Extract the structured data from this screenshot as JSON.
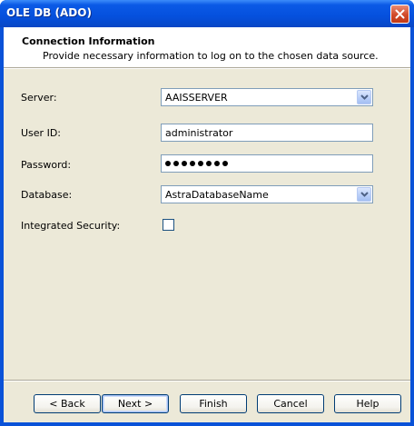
{
  "window": {
    "title": "OLE DB (ADO)"
  },
  "header": {
    "title": "Connection Information",
    "subtitle": "Provide necessary information to log on to the chosen data source."
  },
  "form": {
    "server": {
      "label": "Server:",
      "value": "AAISSERVER"
    },
    "user_id": {
      "label": "User ID:",
      "value": "administrator"
    },
    "password": {
      "label": "Password:",
      "value": "••••••••"
    },
    "database": {
      "label": "Database:",
      "value": "AstraDatabaseName"
    },
    "integrated_security": {
      "label": "Integrated Security:",
      "checked": false
    }
  },
  "buttons": {
    "back": "< Back",
    "next": "Next >",
    "finish": "Finish",
    "cancel": "Cancel",
    "help": "Help"
  },
  "colors": {
    "titlebar": "#0550dd",
    "dialog_bg": "#ece9d8",
    "close_button": "#d14a29"
  }
}
